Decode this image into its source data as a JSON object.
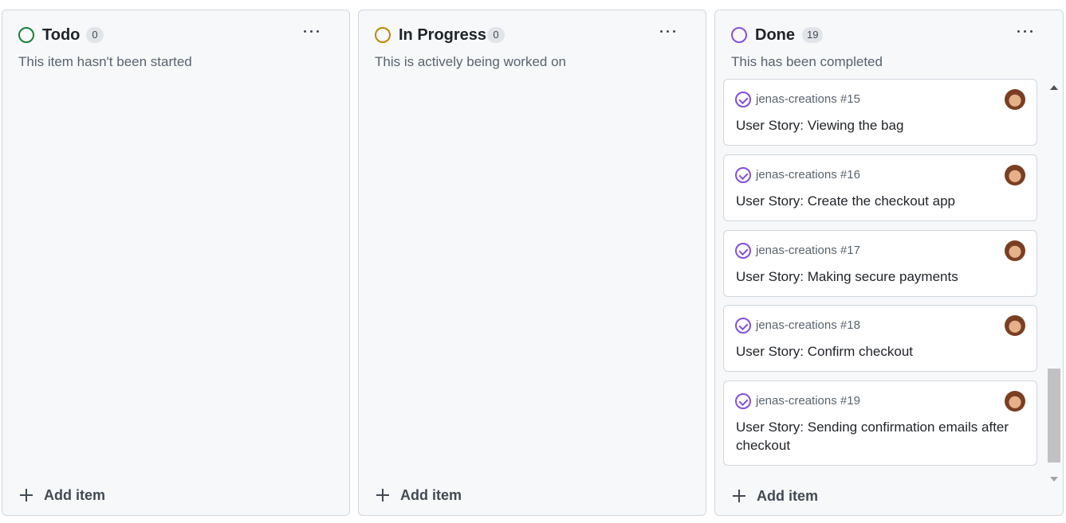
{
  "columns": [
    {
      "title": "Todo",
      "count": "0",
      "description": "This item hasn't been started",
      "status_color": "#1a7f37",
      "add_label": "Add item"
    },
    {
      "title": "In Progress",
      "count": "0",
      "description": "This is actively being worked on",
      "status_color": "#bf8700",
      "add_label": "Add item"
    },
    {
      "title": "Done",
      "count": "19",
      "description": "This has been completed",
      "status_color": "#8250df",
      "add_label": "Add item",
      "cards": [
        {
          "repo": "jenas-creations #15",
          "title": "User Story: Viewing the bag"
        },
        {
          "repo": "jenas-creations #16",
          "title": "User Story: Create the checkout app"
        },
        {
          "repo": "jenas-creations #17",
          "title": "User Story: Making secure payments"
        },
        {
          "repo": "jenas-creations #18",
          "title": "User Story: Confirm checkout"
        },
        {
          "repo": "jenas-creations #19",
          "title": "User Story: Sending confirmation emails after checkout"
        }
      ]
    }
  ],
  "icons": {
    "status": "circle-status-icon",
    "menu": "kebab-menu-icon",
    "add": "plus-icon",
    "card_status": "closed-issue-check-icon",
    "avatar": "user-avatar"
  },
  "colors": {
    "done_accent": "#8250df",
    "todo_accent": "#1a7f37",
    "progress_accent": "#bf8700"
  }
}
